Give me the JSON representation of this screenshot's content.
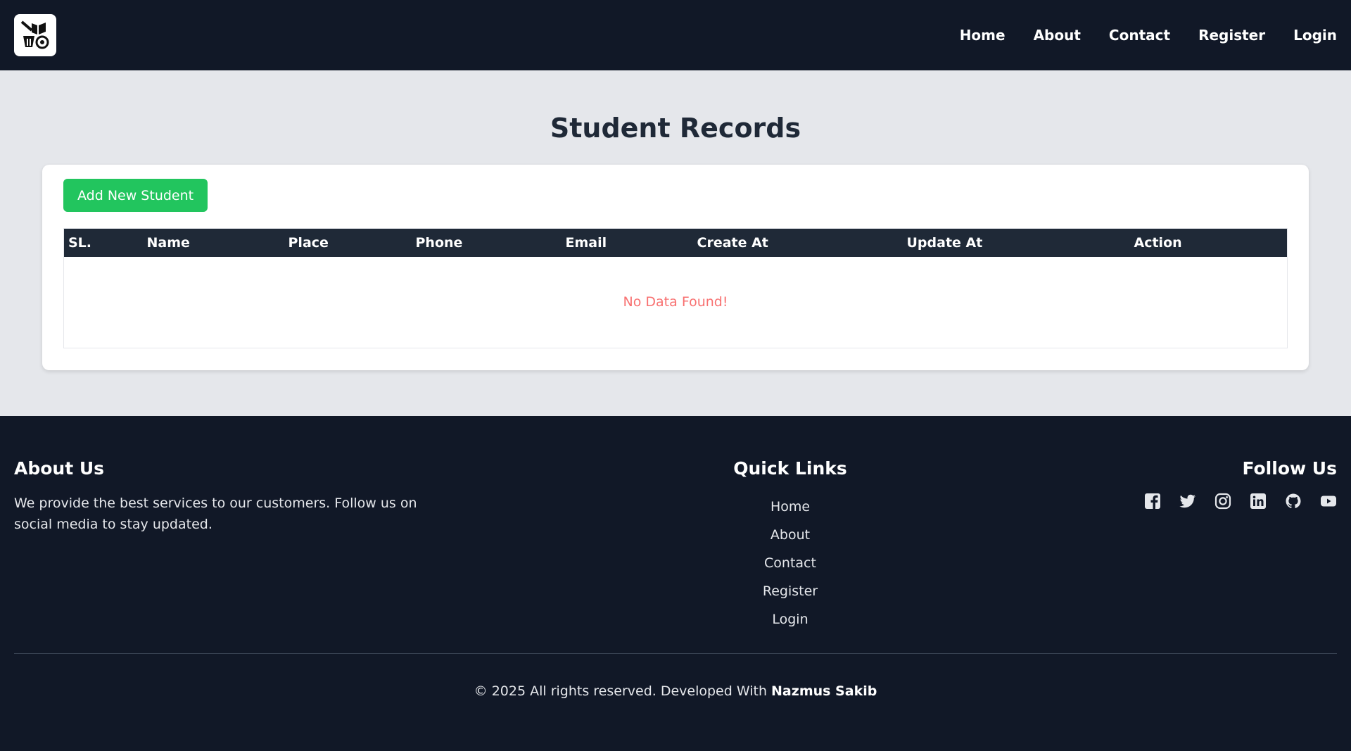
{
  "nav": {
    "logo_icon": "books-basket-icon",
    "links": [
      "Home",
      "About",
      "Contact",
      "Register",
      "Login"
    ]
  },
  "main": {
    "title": "Student Records",
    "add_button": "Add New Student",
    "columns": [
      "SL.",
      "Name",
      "Place",
      "Phone",
      "Email",
      "Create At",
      "Update At",
      "Action"
    ],
    "empty_message": "No Data Found!"
  },
  "footer": {
    "about_title": "About Us",
    "about_text": "We provide the best services to our customers. Follow us on social media to stay updated.",
    "links_title": "Quick Links",
    "links": [
      "Home",
      "About",
      "Contact",
      "Register",
      "Login"
    ],
    "follow_title": "Follow Us",
    "social": [
      "facebook-icon",
      "twitter-icon",
      "instagram-icon",
      "linkedin-icon",
      "github-icon",
      "youtube-icon"
    ],
    "copyright_prefix": "© 2025 All rights reserved. Developed With",
    "author": "Nazmus Sakib"
  },
  "colors": {
    "nav_bg": "#111827",
    "main_bg": "#e5e7eb",
    "header_row": "#1f2937",
    "add_button": "#22c55e",
    "empty_text": "#f87171"
  }
}
